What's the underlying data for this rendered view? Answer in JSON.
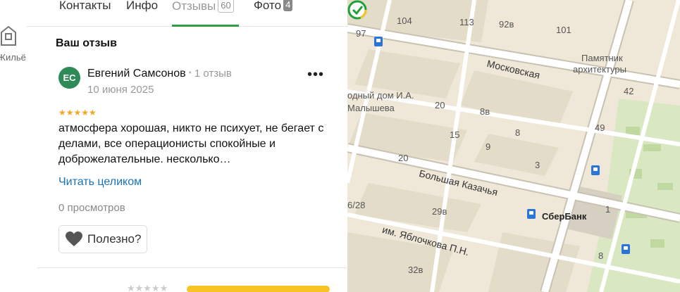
{
  "rail": {
    "item_label": "Жильё"
  },
  "tabs": [
    {
      "label": "Контакты"
    },
    {
      "label": "Инфо"
    },
    {
      "label": "Отзывы",
      "count": "60"
    },
    {
      "label": "Фото",
      "count": "4"
    }
  ],
  "section_title": "Ваш отзыв",
  "review": {
    "avatar_initials": "ЕС",
    "author": "Евгений Самсонов",
    "author_reviews": "1 отзыв",
    "date": "10 июня 2025",
    "rating": 5,
    "stars": "★★★★★",
    "text": "атмосфера хорошая, никто не психует, не бегает с делами, все операционисты спокойные и доброжелательные. несколько…",
    "read_more": "Читать целиком",
    "views": "0 просмотров",
    "useful_label": "Полезно?"
  },
  "next_review": {
    "stars": "★★★★★"
  },
  "map": {
    "streets": [
      "Московская",
      "Большая Казачья",
      "им. Яблочкова П.Н."
    ],
    "poi": [
      {
        "label": "Памятник"
      },
      {
        "label": "архитектуры"
      },
      {
        "label": "одный дом И.А."
      },
      {
        "label": "Малышева"
      },
      {
        "label": "СберБанк"
      }
    ],
    "house_numbers": [
      "104",
      "113",
      "92в",
      "101",
      "97",
      "42",
      "20",
      "8в",
      "8",
      "49",
      "15",
      "9",
      "20",
      "3",
      "1",
      "6/28",
      "29в",
      "8",
      "32в"
    ]
  },
  "colors": {
    "accent": "#2ea043",
    "link": "#1a73b5",
    "star": "#f5a623",
    "avatar": "#2e8b57",
    "rating_bar": "#f7c325"
  }
}
